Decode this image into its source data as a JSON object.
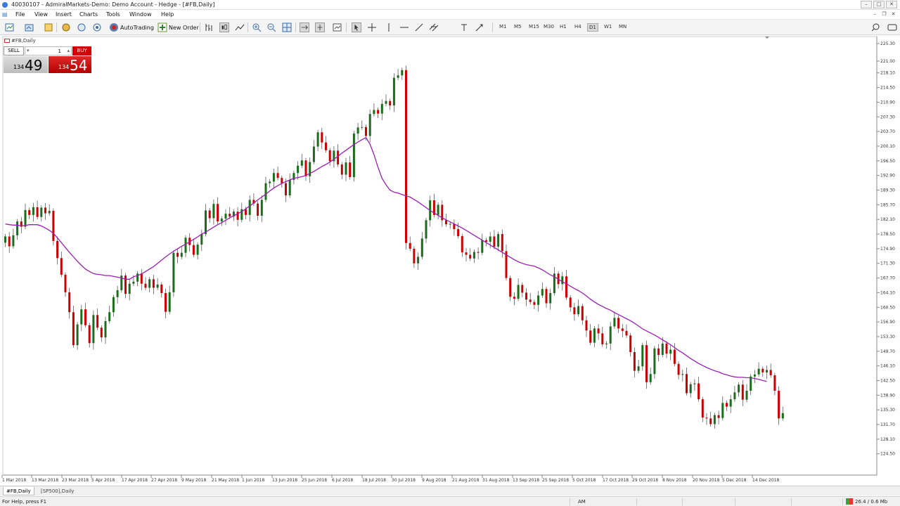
{
  "window": {
    "title": "40030107 - AdmiralMarkets-Demo: Demo Account - Hedge - [#FB,Daily]"
  },
  "menu": [
    "File",
    "View",
    "Insert",
    "Charts",
    "Tools",
    "Window",
    "Help"
  ],
  "toolbar": {
    "autotrading_label": "AutoTrading",
    "new_order_label": "New Order",
    "timeframes": [
      "M1",
      "M5",
      "M15",
      "M30",
      "H1",
      "H4",
      "D1",
      "W1",
      "MN"
    ],
    "active_timeframe": "D1"
  },
  "chart": {
    "title": "#FB,Daily"
  },
  "trade_panel": {
    "sell_label": "SELL",
    "buy_label": "BUY",
    "lot": "1",
    "bid_prefix": "134",
    "bid_big": "49",
    "ask_prefix": "134",
    "ask_big": "54"
  },
  "chart_data": {
    "type": "candlestick",
    "symbol": "#FB",
    "timeframe": "Daily",
    "y_ticks": [
      "225.30",
      "221.00",
      "218.10",
      "214.50",
      "210.90",
      "207.30",
      "203.70",
      "200.10",
      "196.50",
      "192.90",
      "189.30",
      "185.70",
      "182.10",
      "178.50",
      "174.90",
      "171.30",
      "167.70",
      "164.10",
      "160.50",
      "156.90",
      "153.30",
      "149.70",
      "146.10",
      "142.50",
      "138.90",
      "135.30",
      "131.70",
      "128.10",
      "124.50"
    ],
    "x_ticks": [
      "1 Mar 2018",
      "13 Mar 2018",
      "23 Mar 2018",
      "5 Apr 2018",
      "17 Apr 2018",
      "27 Apr 2018",
      "9 May 2018",
      "21 May 2018",
      "1 Jun 2018",
      "13 Jun 2018",
      "25 Jun 2018",
      "6 Jul 2018",
      "18 Jul 2018",
      "30 Jul 2018",
      "9 Aug 2018",
      "21 Aug 2018",
      "31 Aug 2018",
      "13 Sep 2018",
      "25 Sep 2018",
      "5 Oct 2018",
      "17 Oct 2018",
      "29 Oct 2018",
      "8 Nov 2018",
      "20 Nov 2018",
      "5 Dec 2018",
      "14 Dec 2018"
    ],
    "ylim": [
      122.9,
      226.0
    ],
    "bull_color": "#1a6d1a",
    "bear_color": "#cc0000",
    "ma_color": "#9b1fb4",
    "closes": [
      177.9,
      175.5,
      178.2,
      181.6,
      180.3,
      184.4,
      183.2,
      185.1,
      182.7,
      185.0,
      183.6,
      184.2,
      176.8,
      172.6,
      168.5,
      164.2,
      159.3,
      151.2,
      156.3,
      160.0,
      156.1,
      151.7,
      158.6,
      155.5,
      153.1,
      157.1,
      159.3,
      163.0,
      164.7,
      168.3,
      163.8,
      166.3,
      166.8,
      168.8,
      166.3,
      165.3,
      167.4,
      165.3,
      166.1,
      164.0,
      159.4,
      164.2,
      173.9,
      172.9,
      173.9,
      177.6,
      175.8,
      173.4,
      175.9,
      178.5,
      184.3,
      182.4,
      185.9,
      181.6,
      182.3,
      183.5,
      182.8,
      184.0,
      182.0,
      184.6,
      183.2,
      186.9,
      186.0,
      183.0,
      186.9,
      191.0,
      191.4,
      193.5,
      192.3,
      191.0,
      188.0,
      191.8,
      193.5,
      195.3,
      196.6,
      192.7,
      196.2,
      200.0,
      203.5,
      201.0,
      199.1,
      196.4,
      199.0,
      195.6,
      193.1,
      196.1,
      192.5,
      203.2,
      204.7,
      204.8,
      202.6,
      208.0,
      209.0,
      208.1,
      210.5,
      211.2,
      210.1,
      216.9,
      217.5,
      218.8,
      176.3,
      174.9,
      171.3,
      172.9,
      177.4,
      181.9,
      186.8,
      183.2,
      185.7,
      181.9,
      180.9,
      181.0,
      179.7,
      178.0,
      174.0,
      173.4,
      172.5,
      174.1,
      173.9,
      177.0,
      176.6,
      177.9,
      175.4,
      178.5,
      174.3,
      167.7,
      163.1,
      162.6,
      166.0,
      164.1,
      162.4,
      161.8,
      161.1,
      163.4,
      165.0,
      161.5,
      164.0,
      168.8,
      166.2,
      168.1,
      162.9,
      160.5,
      158.8,
      160.8,
      157.3,
      154.8,
      151.8,
      155.3,
      154.1,
      151.4,
      151.6,
      155.8,
      157.9,
      155.3,
      154.7,
      153.6,
      149.5,
      144.9,
      146.0,
      151.2,
      142.1,
      144.1,
      150.4,
      148.8,
      151.6,
      149.1,
      150.1,
      146.6,
      143.9,
      144.1,
      139.4,
      141.6,
      141.8,
      137.9,
      133.4,
      133.2,
      131.8,
      134.0,
      133.3,
      137.0,
      136.1,
      137.9,
      139.6,
      141.5,
      137.8,
      140.0,
      143.5,
      144.0,
      145.4,
      144.5,
      145.1,
      143.8,
      140.0,
      133.2,
      134.5
    ],
    "ma": [
      181.0,
      180.8,
      180.7,
      180.7,
      180.5,
      180.6,
      180.8,
      180.8,
      180.8,
      180.5,
      180.0,
      179.4,
      178.7,
      177.6,
      176.4,
      175.2,
      174.0,
      172.9,
      171.8,
      170.8,
      169.9,
      169.3,
      168.8,
      168.6,
      168.5,
      168.3,
      168.3,
      168.1,
      167.9,
      167.7,
      167.4,
      167.4,
      168.0,
      168.3,
      168.7,
      169.3,
      169.9,
      170.5,
      171.3,
      172.1,
      172.9,
      173.6,
      174.3,
      174.9,
      175.5,
      176.0,
      176.6,
      177.2,
      177.8,
      178.5,
      179.0,
      179.6,
      180.2,
      180.8,
      181.3,
      181.9,
      182.5,
      183.0,
      183.5,
      184.0,
      184.7,
      185.4,
      186.1,
      186.9,
      187.6,
      188.3,
      189.1,
      189.8,
      190.4,
      190.9,
      191.4,
      191.8,
      192.2,
      192.4,
      192.6,
      192.9,
      193.4,
      193.9,
      194.5,
      195.1,
      195.6,
      196.2,
      196.9,
      197.6,
      198.4,
      199.1,
      199.8,
      200.5,
      201.1,
      201.7,
      202.2,
      200.6,
      198.0,
      194.9,
      192.2,
      190.6,
      189.3,
      188.8,
      188.6,
      188.2,
      187.9,
      187.6,
      187.0,
      186.4,
      185.7,
      185.0,
      184.3,
      183.7,
      183.1,
      182.5,
      182.0,
      181.5,
      181.0,
      180.5,
      180.0,
      179.4,
      178.8,
      178.2,
      177.6,
      177.0,
      176.4,
      175.8,
      175.2,
      174.6,
      174.0,
      173.4,
      172.8,
      172.2,
      171.7,
      171.3,
      171.0,
      170.8,
      170.6,
      170.2,
      169.7,
      169.1,
      168.5,
      168.0,
      167.4,
      166.8,
      166.3,
      165.7,
      165.1,
      164.6,
      164.0,
      163.3,
      162.5,
      161.8,
      161.2,
      160.7,
      160.2,
      159.8,
      159.2,
      158.7,
      158.2,
      157.7,
      157.2,
      156.6,
      155.9,
      155.2,
      154.7,
      154.2,
      153.7,
      153.1,
      152.5,
      151.9,
      151.3,
      150.6,
      149.9,
      149.3,
      148.6,
      147.9,
      147.3,
      146.7,
      146.2,
      145.7,
      145.3,
      144.9,
      144.6,
      144.2,
      143.9,
      143.6,
      143.4,
      143.3,
      143.3,
      143.2,
      143.2,
      143.0,
      142.8,
      142.5,
      142.3
    ]
  },
  "tabs": [
    "#FB,Daily",
    "[SP500],Daily"
  ],
  "status": {
    "help": "For Help, press F1",
    "ampm": "AM",
    "traffic": "26.4 / 0.6 Mb"
  }
}
